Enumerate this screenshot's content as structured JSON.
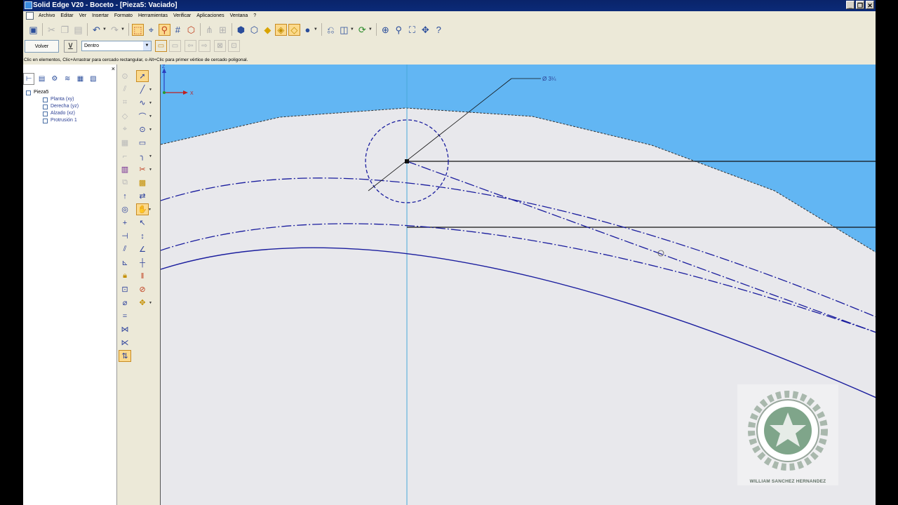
{
  "window": {
    "title": "Solid Edge V20 - Boceto - [Pieza5: Vaciado]",
    "controls": [
      "_",
      "❐",
      "✕"
    ]
  },
  "menu": {
    "items": [
      "Archivo",
      "Editar",
      "Ver",
      "Insertar",
      "Formato",
      "Herramientas",
      "Verificar",
      "Aplicaciones",
      "Ventana",
      "?"
    ]
  },
  "toolbar": {
    "icons": [
      "save-icon",
      "cut-icon",
      "copy-icon",
      "paste-icon",
      "undo-icon",
      "redo-icon",
      "select-tool-icon",
      "smart-select-icon",
      "smart-dimension-icon",
      "grid-icon",
      "sketch-view-icon",
      "view-orientation-icon",
      "fit-icon",
      "zoom-area-icon",
      "zoom-icon",
      "pan-icon",
      "help-icon"
    ]
  },
  "ribbon": {
    "volver_label": "Volver",
    "selection_value": "Dentro"
  },
  "status": {
    "hint": "Clic en elementos, Clic+Arrastrar para cercado rectangular, o Alt+Clic para primer vértice de cercado poligonal."
  },
  "pathfinder": {
    "close_label": "×",
    "tree": {
      "root": "Pieza5",
      "children": [
        "Planta (xy)",
        "Derecha (yz)",
        "Alzado (xz)",
        "Protrusión 1"
      ]
    }
  },
  "canvas": {
    "dimension_label": "Ø 3¼",
    "axis_z": "Z",
    "axis_x": "X",
    "watermark_caption": "WILLIAM SANCHEZ HERNANDEZ"
  },
  "colors": {
    "sky": "#62b6f3",
    "sketch_bg": "#e8e8ec",
    "sketch_line": "#1a1d9e",
    "titlebar": "#0a246a",
    "highlight": "#fbd98c"
  }
}
